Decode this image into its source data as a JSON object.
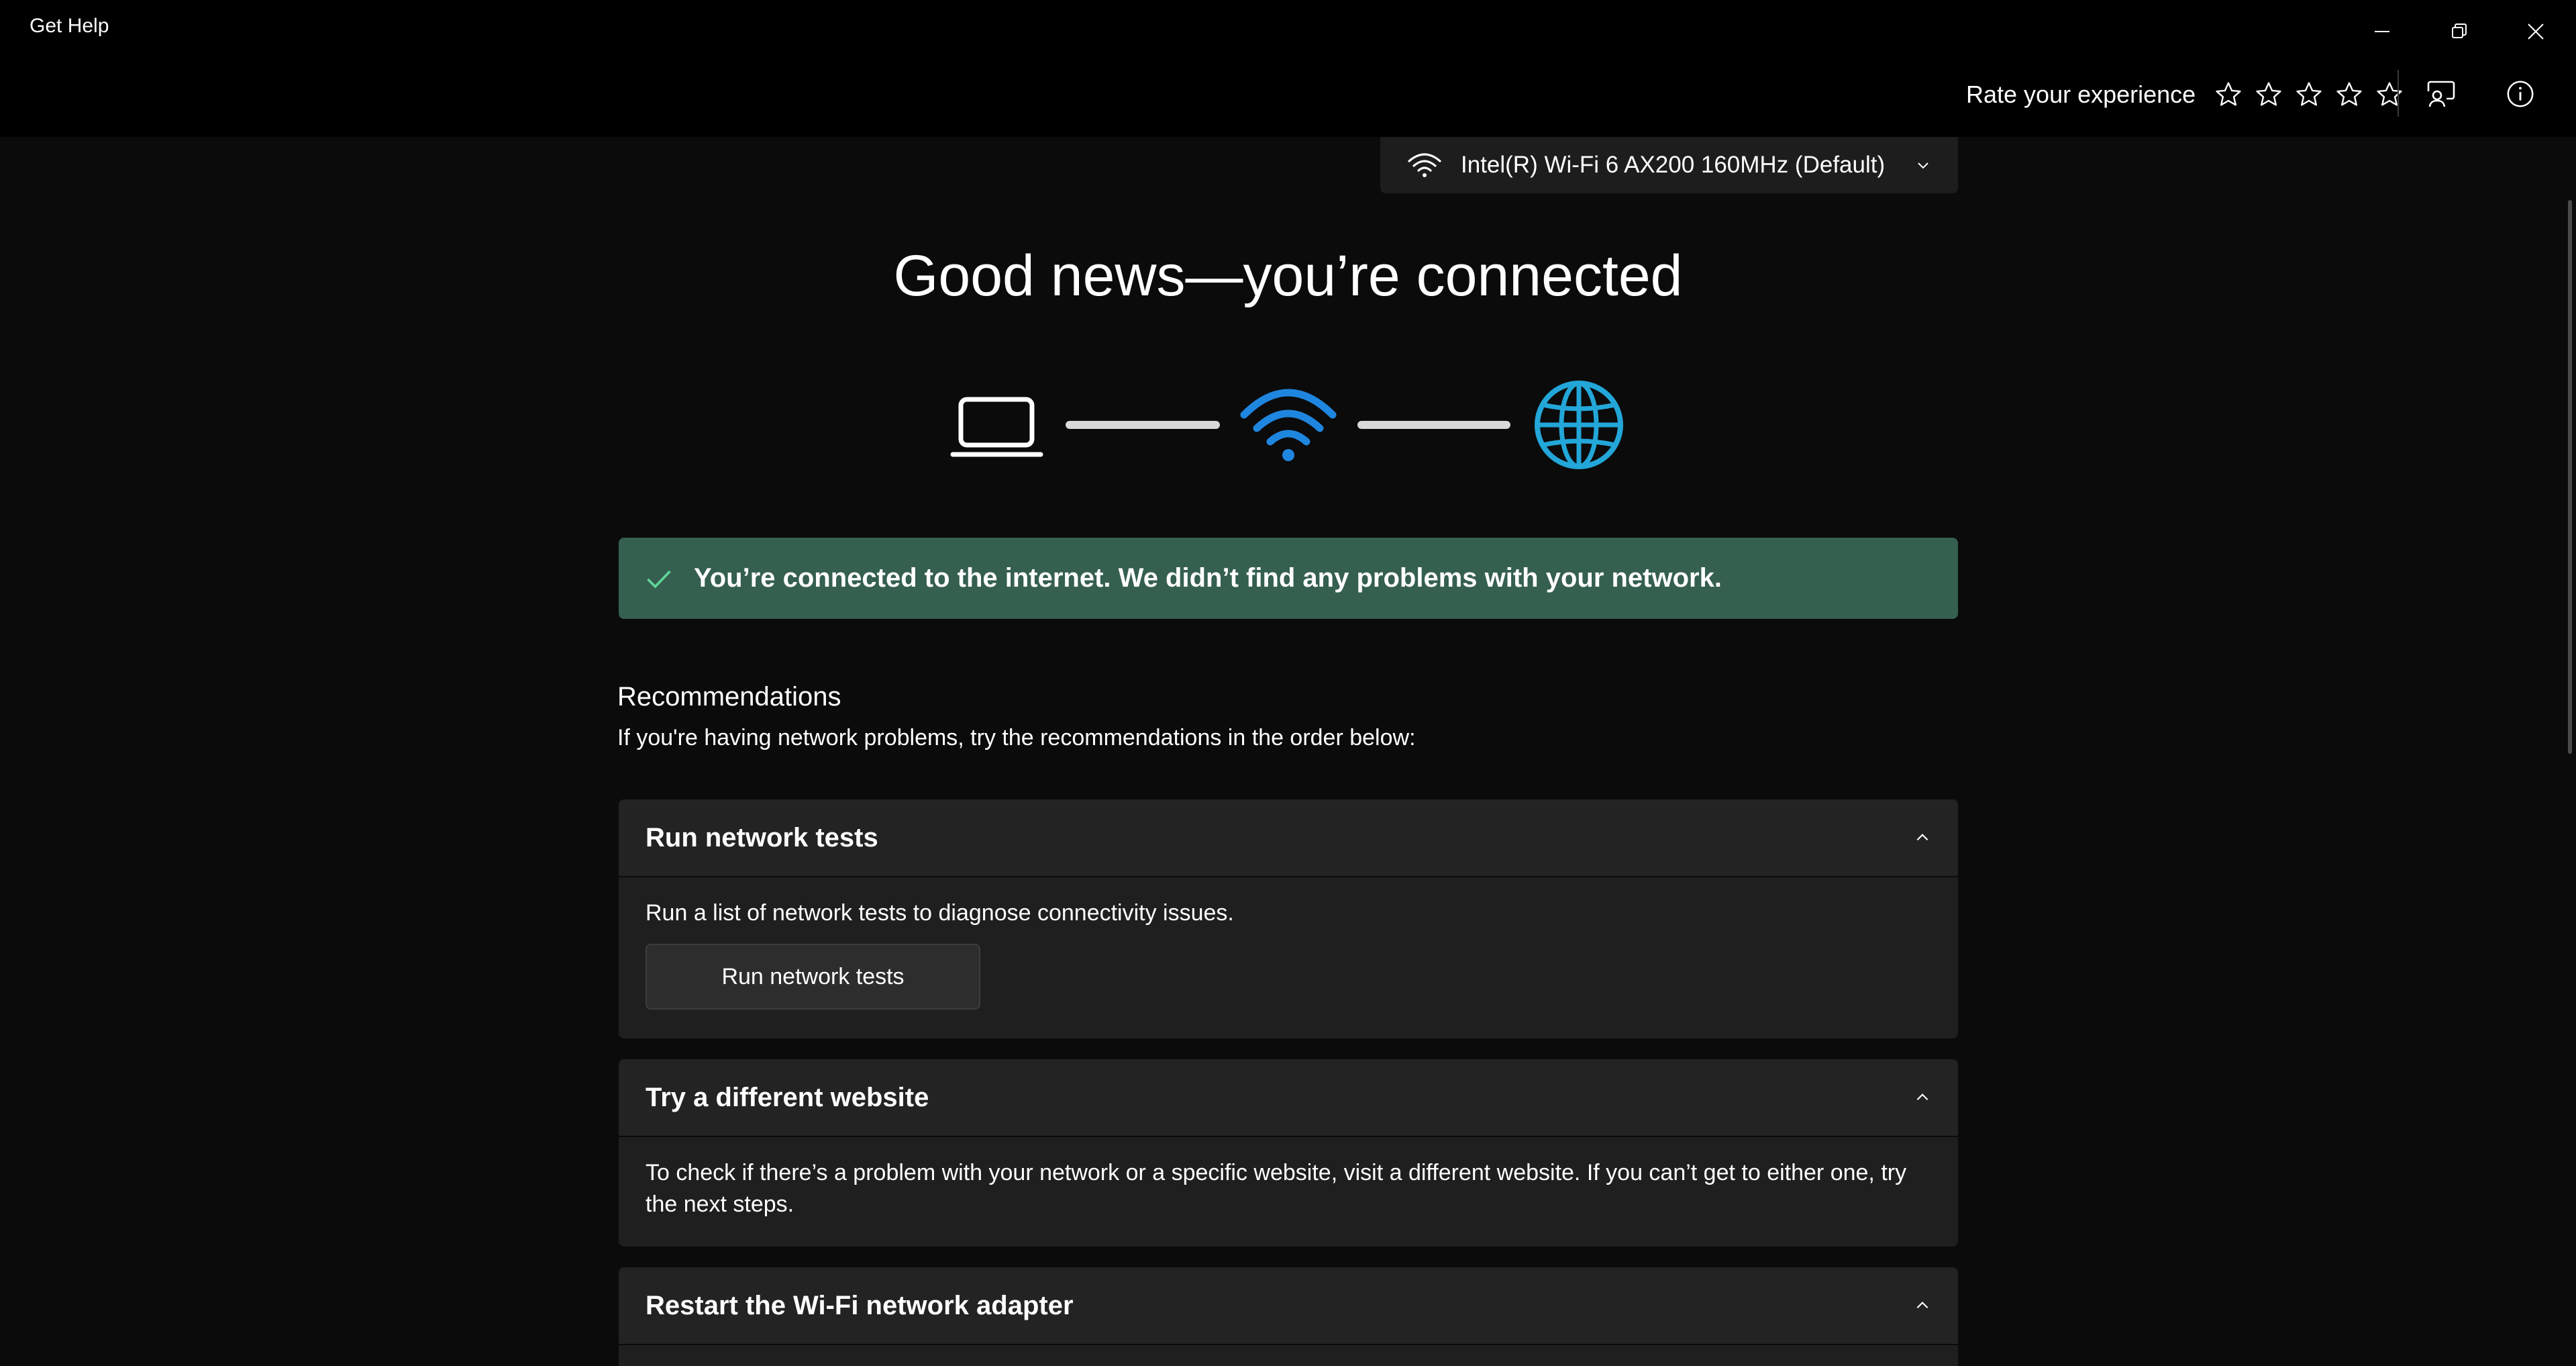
{
  "window": {
    "title": "Get Help"
  },
  "toolbar": {
    "rate_label": "Rate your experience",
    "stars": 5
  },
  "adapter": {
    "selected": "Intel(R) Wi-Fi 6 AX200 160MHz (Default)"
  },
  "headline": "Good news—you’re connected",
  "status": {
    "text": "You’re connected to the internet. We didn’t find any problems with your network.",
    "color": "#355f4f"
  },
  "recommendations": {
    "title": "Recommendations",
    "subtitle": "If you're having network problems, try the recommendations in the order below:",
    "cards": [
      {
        "title": "Run network tests",
        "body": "Run a list of network tests to diagnose connectivity issues.",
        "button": "Run network tests"
      },
      {
        "title": "Try a different website",
        "body": "To check if there’s a problem with your network or a specific website, visit a different website. If you can’t get to either one, try the next steps."
      },
      {
        "title": "Restart the Wi-Fi network adapter"
      }
    ]
  },
  "colors": {
    "accent_blue": "#1f86e0",
    "globe_cyan": "#23a6d8",
    "success_green": "#5fd39a"
  }
}
